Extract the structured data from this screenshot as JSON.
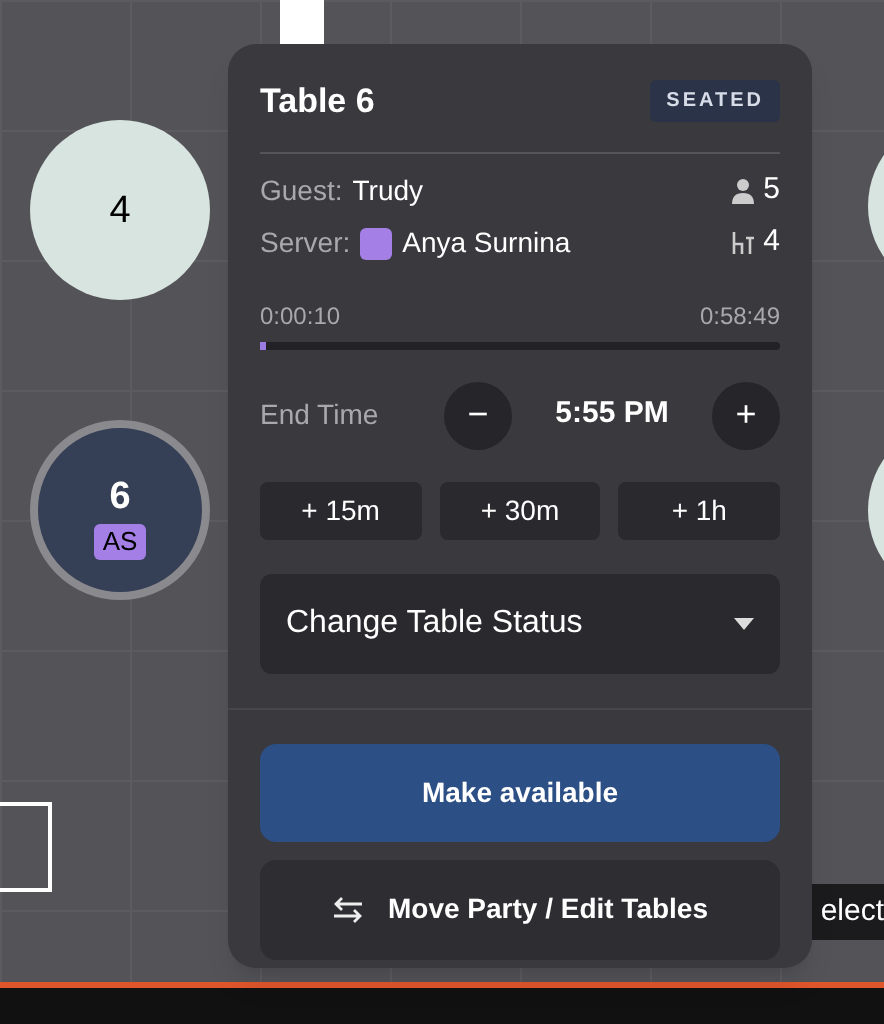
{
  "floor_tables": [
    {
      "number": "4",
      "selected": false
    },
    {
      "number": "6",
      "selected": true,
      "server_badge": "AS",
      "color": "#a37fe6"
    }
  ],
  "select_button": {
    "label": "elect"
  },
  "popup": {
    "title": "Table 6",
    "status": "SEATED",
    "guest_label": "Guest:",
    "guest": "Trudy",
    "party_size": "5",
    "server_label": "Server:",
    "server": {
      "name": "Anya Surnina",
      "color": "#a37fe6"
    },
    "seats": "4",
    "elapsed": "0:00:10",
    "remaining": "0:58:49",
    "level": 0.01,
    "end_time_label": "End Time",
    "end_time": "5:55 PM",
    "minus": "−",
    "plus": "+",
    "quick_adds": [
      "+ 15m",
      "+ 30m",
      "+ 1h"
    ],
    "status_dropdown": "Change Table Status",
    "primary_action": "Make available",
    "secondary_action": "Move Party / Edit Tables"
  }
}
